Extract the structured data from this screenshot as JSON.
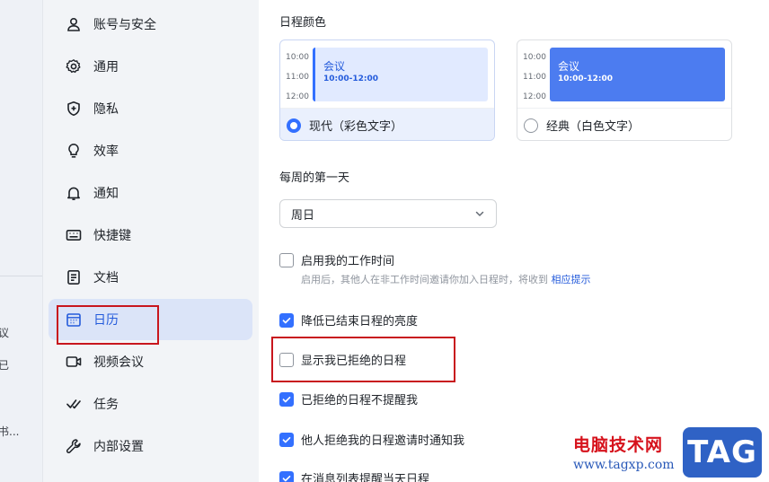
{
  "left_fragments": [
    "议",
    "已",
    "书..."
  ],
  "nav": {
    "items": [
      {
        "label": "账号与安全",
        "icon": "user-icon"
      },
      {
        "label": "通用",
        "icon": "gear-icon"
      },
      {
        "label": "隐私",
        "icon": "shield-icon"
      },
      {
        "label": "效率",
        "icon": "lightbulb-icon"
      },
      {
        "label": "通知",
        "icon": "bell-icon"
      },
      {
        "label": "快捷键",
        "icon": "keyboard-icon"
      },
      {
        "label": "文档",
        "icon": "document-icon"
      },
      {
        "label": "日历",
        "icon": "calendar-icon",
        "active": true
      },
      {
        "label": "视频会议",
        "icon": "video-icon"
      },
      {
        "label": "任务",
        "icon": "task-check-icon"
      },
      {
        "label": "内部设置",
        "icon": "wrench-icon"
      }
    ]
  },
  "main": {
    "color_section_title": "日程颜色",
    "themes": [
      {
        "times": [
          "10:00",
          "11:00",
          "12:00"
        ],
        "event_title": "会议",
        "event_time": "10:00-12:00",
        "label": "现代（彩色文字）",
        "selected": true
      },
      {
        "times": [
          "10:00",
          "11:00",
          "12:00"
        ],
        "event_title": "会议",
        "event_time": "10:00-12:00",
        "label": "经典（白色文字）",
        "selected": false
      }
    ],
    "week_start_title": "每周的第一天",
    "week_start_value": "周日",
    "options": [
      {
        "label": "启用我的工作时间",
        "checked": false
      },
      {
        "label": "降低已结束日程的亮度",
        "checked": true
      },
      {
        "label": "显示我已拒绝的日程",
        "checked": false
      },
      {
        "label": "已拒绝的日程不提醒我",
        "checked": true
      },
      {
        "label": "他人拒绝我的日程邀请时通知我",
        "checked": true
      },
      {
        "label": "在消息列表提醒当天日程",
        "checked": true
      }
    ],
    "work_hours_hint": "启用后，其他人在非工作时间邀请你加入日程时，将收到",
    "work_hours_hint_link": "相应提示"
  },
  "watermark": {
    "text": "电脑技术网",
    "url": "www.tagxp.com",
    "badge": "TAG"
  },
  "colors": {
    "accent": "#3370ff",
    "highlight_box": "#c8161d",
    "nav_active_bg": "#dbe4f8"
  }
}
